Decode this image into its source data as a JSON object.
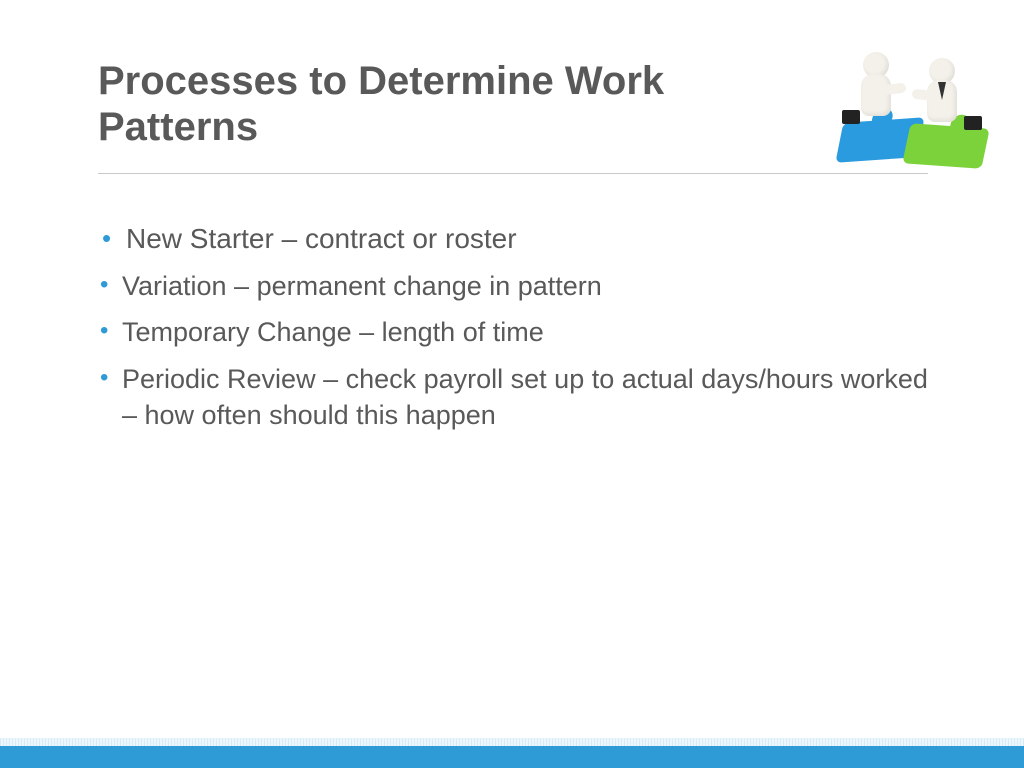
{
  "title": "Processes to Determine Work Patterns",
  "bullets": [
    "New Starter – contract or roster",
    "Variation – permanent change in pattern",
    "Temporary Change – length of time",
    "Periodic Review – check payroll set up to actual days/hours worked – how often should this happen"
  ],
  "illustration_alt": "handshake-figures-on-puzzle-icon"
}
